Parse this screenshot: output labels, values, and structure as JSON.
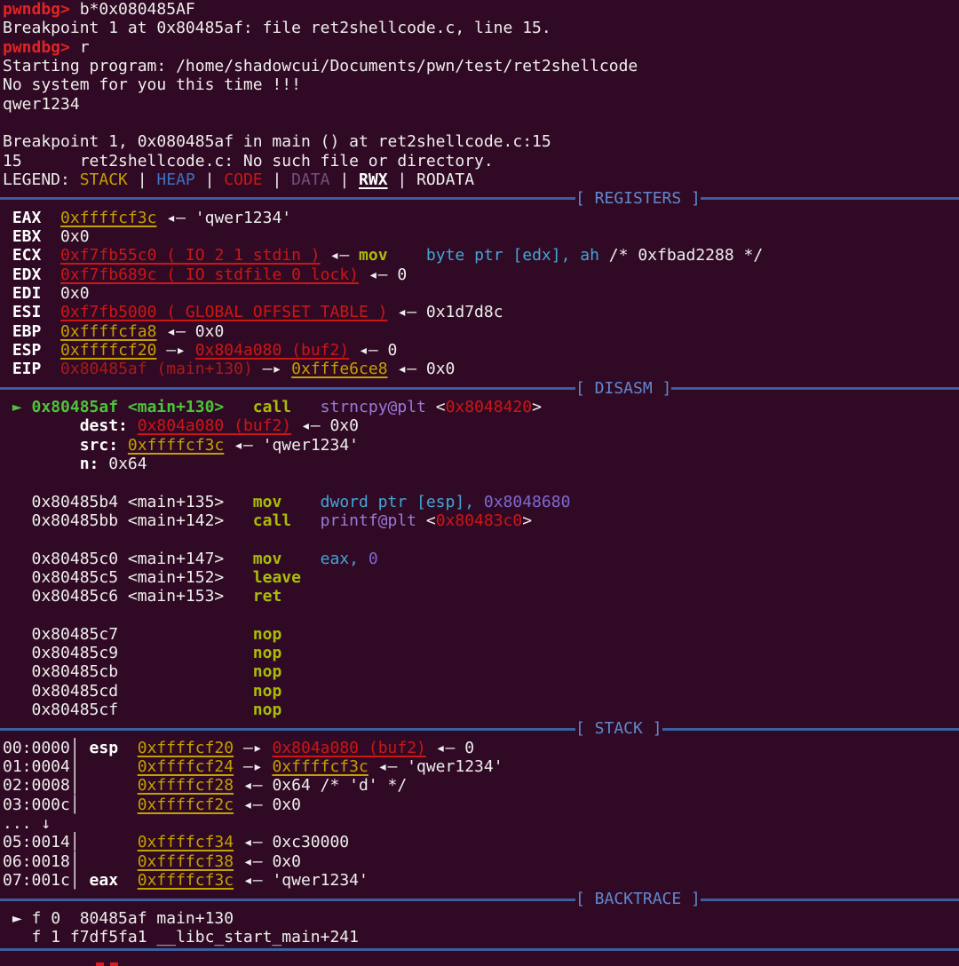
{
  "terminal": {
    "colors": {
      "background": "#300a24",
      "foreground": "#eeeeec",
      "prompt_red": "#e32222",
      "address_yellow": "#c4a000",
      "symbol_red": "#cc1616",
      "current_green": "#4cc43a",
      "mnemonic_olive": "#a9bd07",
      "operand_cyan": "#42a5d7",
      "plt_purple": "#9a7ad9",
      "section_blue": "#6188d0",
      "rule_blue": "#3a5fa3"
    },
    "lines": [
      {
        "name": "prompt-line-breakpoint",
        "segs": [
          [
            "pwndbg> ",
            "prompt",
            "pwndbg-prompt"
          ],
          [
            "b*0x080485AF",
            "fg",
            "command-text"
          ]
        ]
      },
      {
        "name": "output-breakpoint-set",
        "segs": [
          [
            "Breakpoint 1 at 0x80485af: file ret2shellcode.c, line 15.",
            "fg"
          ]
        ]
      },
      {
        "name": "prompt-line-run",
        "segs": [
          [
            "pwndbg> ",
            "prompt",
            "pwndbg-prompt"
          ],
          [
            "r",
            "fg",
            "command-text"
          ]
        ]
      },
      {
        "name": "output-starting-program",
        "segs": [
          [
            "Starting program: /home/shadowcui/Documents/pwn/test/ret2shellcode",
            "fg"
          ]
        ]
      },
      {
        "name": "program-output",
        "segs": [
          [
            "No system for you this time !!!",
            "fg"
          ]
        ]
      },
      {
        "name": "program-input-echo",
        "segs": [
          [
            "qwer1234",
            "fg"
          ]
        ]
      },
      {
        "name": "blank-line",
        "segs": []
      },
      {
        "name": "output-breakpoint-hit",
        "segs": [
          [
            "Breakpoint 1, 0x080485af in main () at ret2shellcode.c:15",
            "fg"
          ]
        ]
      },
      {
        "name": "output-source-missing",
        "segs": [
          [
            "15      ret2shellcode.c: No such file or directory.",
            "fg"
          ]
        ]
      },
      {
        "name": "legend-line",
        "segs": [
          [
            "LEGEND: ",
            "fg"
          ],
          [
            "STACK",
            "yelp",
            "legend-stack"
          ],
          [
            " | ",
            "fg"
          ],
          [
            "HEAP",
            "blu",
            "legend-heap"
          ],
          [
            " | ",
            "fg"
          ],
          [
            "CODE",
            "red",
            "legend-code"
          ],
          [
            " | ",
            "fg"
          ],
          [
            "DATA",
            "dt",
            "legend-data"
          ],
          [
            " | ",
            "fg"
          ],
          [
            "RWX",
            "wbu",
            "legend-rwx"
          ],
          [
            " | ",
            "fg"
          ],
          [
            "RODATA",
            "fg",
            "legend-rodata"
          ]
        ]
      },
      {
        "name": "section-header-registers",
        "rule": true,
        "label": "[ REGISTERS ]"
      },
      {
        "name": "register-row-eax",
        "segs": [
          [
            " ",
            "fg"
          ],
          [
            "EAX",
            "b",
            "register-name"
          ],
          [
            "  ",
            "fg"
          ],
          [
            "0xffffcf3c",
            "yel",
            "stack-address-link"
          ],
          [
            " ◂— 'qwer1234'",
            "fg"
          ]
        ]
      },
      {
        "name": "register-row-ebx",
        "segs": [
          [
            " ",
            "fg"
          ],
          [
            "EBX",
            "b",
            "register-name"
          ],
          [
            "  0x0",
            "fg"
          ]
        ]
      },
      {
        "name": "register-row-ecx",
        "segs": [
          [
            " ",
            "fg"
          ],
          [
            "ECX",
            "b",
            "register-name"
          ],
          [
            "  ",
            "fg"
          ],
          [
            "0xf7fb55c0 (_IO_2_1_stdin_)",
            "redu",
            "symbol-address-link"
          ],
          [
            " ◂— ",
            "fg"
          ],
          [
            "mov",
            "mn"
          ],
          [
            "    ",
            "fg"
          ],
          [
            "byte ptr [edx], ah",
            "cy"
          ],
          [
            " /* 0xfbad2288 */",
            "fg"
          ]
        ]
      },
      {
        "name": "register-row-edx",
        "segs": [
          [
            " ",
            "fg"
          ],
          [
            "EDX",
            "b",
            "register-name"
          ],
          [
            "  ",
            "fg"
          ],
          [
            "0xf7fb689c (_IO_stdfile_0_lock)",
            "redu",
            "symbol-address-link"
          ],
          [
            " ◂— 0",
            "fg"
          ]
        ]
      },
      {
        "name": "register-row-edi",
        "segs": [
          [
            " ",
            "fg"
          ],
          [
            "EDI",
            "b",
            "register-name"
          ],
          [
            "  0x0",
            "fg"
          ]
        ]
      },
      {
        "name": "register-row-esi",
        "segs": [
          [
            " ",
            "fg"
          ],
          [
            "ESI",
            "b",
            "register-name"
          ],
          [
            "  ",
            "fg"
          ],
          [
            "0xf7fb5000 (_GLOBAL_OFFSET_TABLE_)",
            "redu",
            "symbol-address-link"
          ],
          [
            " ◂— 0x1d7d8c",
            "fg"
          ]
        ]
      },
      {
        "name": "register-row-ebp",
        "segs": [
          [
            " ",
            "fg"
          ],
          [
            "EBP",
            "b",
            "register-name"
          ],
          [
            "  ",
            "fg"
          ],
          [
            "0xffffcfa8",
            "yel",
            "stack-address-link"
          ],
          [
            " ◂— 0x0",
            "fg"
          ]
        ]
      },
      {
        "name": "register-row-esp",
        "segs": [
          [
            " ",
            "fg"
          ],
          [
            "ESP",
            "b",
            "register-name"
          ],
          [
            "  ",
            "fg"
          ],
          [
            "0xffffcf20",
            "yel",
            "stack-address-link"
          ],
          [
            " —▸ ",
            "fg"
          ],
          [
            "0x804a080 (buf2)",
            "redu",
            "symbol-address-link"
          ],
          [
            " ◂— 0",
            "fg"
          ]
        ]
      },
      {
        "name": "register-row-eip",
        "segs": [
          [
            " ",
            "fg"
          ],
          [
            "EIP",
            "b",
            "register-name"
          ],
          [
            "  ",
            "fg"
          ],
          [
            "0x80485af (main+130)",
            "dimred",
            "code-address"
          ],
          [
            " —▸ ",
            "fg"
          ],
          [
            "0xfffe6ce8",
            "yel",
            "stack-address-link"
          ],
          [
            " ◂— 0x0",
            "fg"
          ]
        ]
      },
      {
        "name": "section-header-disasm",
        "rule": true,
        "label": "[ DISASM ]"
      },
      {
        "name": "disasm-row-current",
        "segs": [
          [
            " ",
            "fg"
          ],
          [
            "► ",
            "grn",
            "current-instruction-marker"
          ],
          [
            "0x80485af <main+130>",
            "grn",
            "current-instruction-address"
          ],
          [
            "   ",
            "fg"
          ],
          [
            "call",
            "mn",
            "mnemonic"
          ],
          [
            "   ",
            "fg"
          ],
          [
            "strncpy@plt",
            "pu",
            "call-target"
          ],
          [
            " <",
            "fg"
          ],
          [
            "0x8048420",
            "red"
          ],
          [
            ">",
            "fg"
          ]
        ]
      },
      {
        "name": "disasm-arg-dest",
        "segs": [
          [
            "        ",
            "fg"
          ],
          [
            "dest:",
            "b",
            "arg-label"
          ],
          [
            " ",
            "fg"
          ],
          [
            "0x804a080 (buf2)",
            "redu",
            "symbol-address-link"
          ],
          [
            " ◂— 0x0",
            "fg"
          ]
        ]
      },
      {
        "name": "disasm-arg-src",
        "segs": [
          [
            "        ",
            "fg"
          ],
          [
            "src:",
            "b",
            "arg-label"
          ],
          [
            " ",
            "fg"
          ],
          [
            "0xffffcf3c",
            "yel",
            "stack-address-link"
          ],
          [
            " ◂— 'qwer1234'",
            "fg"
          ]
        ]
      },
      {
        "name": "disasm-arg-n",
        "segs": [
          [
            "        ",
            "fg"
          ],
          [
            "n:",
            "b",
            "arg-label"
          ],
          [
            " 0x64",
            "fg"
          ]
        ]
      },
      {
        "name": "blank-line",
        "segs": []
      },
      {
        "name": "disasm-row",
        "segs": [
          [
            "   0x80485b4 <main+135>   ",
            "fg"
          ],
          [
            "mov",
            "mn",
            "mnemonic"
          ],
          [
            "    ",
            "fg"
          ],
          [
            "dword ptr [esp],",
            "cy"
          ],
          [
            " ",
            "fg"
          ],
          [
            "0x8048680",
            "im"
          ]
        ]
      },
      {
        "name": "disasm-row",
        "segs": [
          [
            "   0x80485bb <main+142>   ",
            "fg"
          ],
          [
            "call",
            "mn",
            "mnemonic"
          ],
          [
            "   ",
            "fg"
          ],
          [
            "printf@plt",
            "pu",
            "call-target"
          ],
          [
            " <",
            "fg"
          ],
          [
            "0x80483c0",
            "red"
          ],
          [
            ">",
            "fg"
          ]
        ]
      },
      {
        "name": "blank-line",
        "segs": []
      },
      {
        "name": "disasm-row",
        "segs": [
          [
            "   0x80485c0 <main+147>   ",
            "fg"
          ],
          [
            "mov",
            "mn",
            "mnemonic"
          ],
          [
            "    ",
            "fg"
          ],
          [
            "eax,",
            "cy"
          ],
          [
            " ",
            "fg"
          ],
          [
            "0",
            "im"
          ]
        ]
      },
      {
        "name": "disasm-row",
        "segs": [
          [
            "   0x80485c5 <main+152>   ",
            "fg"
          ],
          [
            "leave",
            "mn",
            "mnemonic"
          ]
        ]
      },
      {
        "name": "disasm-row",
        "segs": [
          [
            "   0x80485c6 <main+153>   ",
            "fg"
          ],
          [
            "ret",
            "mn",
            "mnemonic"
          ]
        ]
      },
      {
        "name": "blank-line",
        "segs": []
      },
      {
        "name": "disasm-row",
        "segs": [
          [
            "   0x80485c7              ",
            "fg"
          ],
          [
            "nop",
            "mn",
            "mnemonic"
          ]
        ]
      },
      {
        "name": "disasm-row",
        "segs": [
          [
            "   0x80485c9              ",
            "fg"
          ],
          [
            "nop",
            "mn",
            "mnemonic"
          ]
        ]
      },
      {
        "name": "disasm-row",
        "segs": [
          [
            "   0x80485cb              ",
            "fg"
          ],
          [
            "nop",
            "mn",
            "mnemonic"
          ]
        ]
      },
      {
        "name": "disasm-row",
        "segs": [
          [
            "   0x80485cd              ",
            "fg"
          ],
          [
            "nop",
            "mn",
            "mnemonic"
          ]
        ]
      },
      {
        "name": "disasm-row",
        "segs": [
          [
            "   0x80485cf              ",
            "fg"
          ],
          [
            "nop",
            "mn",
            "mnemonic"
          ]
        ]
      },
      {
        "name": "section-header-stack",
        "rule": true,
        "label": "[ STACK ]"
      },
      {
        "name": "stack-row-0",
        "segs": [
          [
            "00:0000│ ",
            "fg"
          ],
          [
            "esp",
            "b",
            "register-name"
          ],
          [
            "  ",
            "fg"
          ],
          [
            "0xffffcf20",
            "yel",
            "stack-address-link"
          ],
          [
            " —▸ ",
            "fg"
          ],
          [
            "0x804a080 (buf2)",
            "redu",
            "symbol-address-link"
          ],
          [
            " ◂— 0",
            "fg"
          ]
        ]
      },
      {
        "name": "stack-row-1",
        "segs": [
          [
            "01:0004│      ",
            "fg"
          ],
          [
            "0xffffcf24",
            "yel",
            "stack-address-link"
          ],
          [
            " —▸ ",
            "fg"
          ],
          [
            "0xffffcf3c",
            "yel",
            "stack-address-link"
          ],
          [
            " ◂— 'qwer1234'",
            "fg"
          ]
        ]
      },
      {
        "name": "stack-row-2",
        "segs": [
          [
            "02:0008│      ",
            "fg"
          ],
          [
            "0xffffcf28",
            "yel",
            "stack-address-link"
          ],
          [
            " ◂— 0x64 /* 'd' */",
            "fg"
          ]
        ]
      },
      {
        "name": "stack-row-3",
        "segs": [
          [
            "03:000c│      ",
            "fg"
          ],
          [
            "0xffffcf2c",
            "yel",
            "stack-address-link"
          ],
          [
            " ◂— 0x0",
            "fg"
          ]
        ]
      },
      {
        "name": "stack-ellipsis",
        "segs": [
          [
            "... ↓",
            "fg"
          ]
        ]
      },
      {
        "name": "stack-row-5",
        "segs": [
          [
            "05:0014│      ",
            "fg"
          ],
          [
            "0xffffcf34",
            "yel",
            "stack-address-link"
          ],
          [
            " ◂— 0xc30000",
            "fg"
          ]
        ]
      },
      {
        "name": "stack-row-6",
        "segs": [
          [
            "06:0018│      ",
            "fg"
          ],
          [
            "0xffffcf38",
            "yel",
            "stack-address-link"
          ],
          [
            " ◂— 0x0",
            "fg"
          ]
        ]
      },
      {
        "name": "stack-row-7",
        "segs": [
          [
            "07:001c│ ",
            "fg"
          ],
          [
            "eax",
            "b",
            "register-name"
          ],
          [
            "  ",
            "fg"
          ],
          [
            "0xffffcf3c",
            "yel",
            "stack-address-link"
          ],
          [
            " ◂— 'qwer1234'",
            "fg"
          ]
        ]
      },
      {
        "name": "section-header-backtrace",
        "rule": true,
        "label": "[ BACKTRACE ]"
      },
      {
        "name": "backtrace-frame-0",
        "segs": [
          [
            " ► ",
            "fg",
            "current-frame-marker"
          ],
          [
            "f 0  80485af main+130",
            "fg"
          ]
        ]
      },
      {
        "name": "backtrace-frame-1",
        "segs": [
          [
            "   f 1 f7df5fa1 __libc_start_main+241",
            "fg"
          ]
        ]
      },
      {
        "name": "epilog-rule-line",
        "rule": true,
        "epilog": true
      }
    ]
  }
}
